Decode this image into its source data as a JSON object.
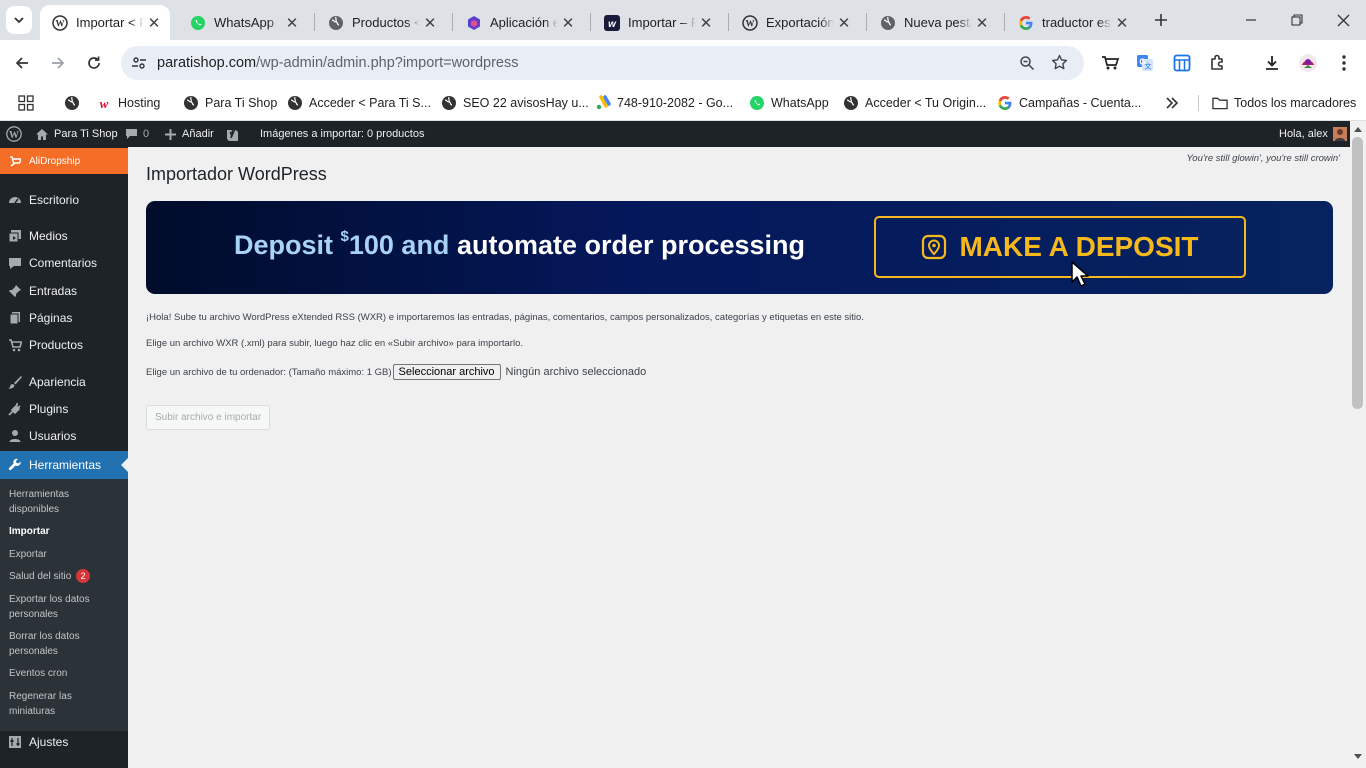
{
  "browser": {
    "tabs": [
      {
        "label": "Importar < P",
        "icon": "wordpress-icon",
        "active": true
      },
      {
        "label": "WhatsApp",
        "icon": "whatsapp-icon"
      },
      {
        "label": "Productos <",
        "icon": "globe-icon"
      },
      {
        "label": "Aplicación e",
        "icon": "app-icon"
      },
      {
        "label": "Importar – P",
        "icon": "w-logo-icon"
      },
      {
        "label": "Exportación",
        "icon": "wordpress-icon"
      },
      {
        "label": "Nueva pesta",
        "icon": "globe-icon"
      },
      {
        "label": "traductor es",
        "icon": "google-icon"
      }
    ],
    "url_domain": "paratishop.com",
    "url_path": "/wp-admin/admin.php?import=wordpress",
    "bookmarks": [
      {
        "label": "Hosting",
        "icon": "hosting-icon"
      },
      {
        "label": "Para Ti Shop",
        "icon": "globe-icon"
      },
      {
        "label": "Acceder < Para Ti S...",
        "icon": "globe-icon"
      },
      {
        "label": "SEO 22 avisosHay u...",
        "icon": "globe-icon"
      },
      {
        "label": "748-910-2082 - Go...",
        "icon": "google-ads-icon"
      },
      {
        "label": "WhatsApp",
        "icon": "whatsapp-icon"
      },
      {
        "label": "Acceder < Tu Origin...",
        "icon": "globe-icon"
      },
      {
        "label": "Campañas - Cuenta...",
        "icon": "google-icon"
      }
    ],
    "all_bookmarks": "Todos los marcadores"
  },
  "adminbar": {
    "site": "Para Ti Shop",
    "comments": "0",
    "add": "Añadir",
    "import_notice": "Imágenes a importar: 0 productos",
    "greeting": "Hola, alex"
  },
  "sidebar": {
    "top_item": "AliDropship",
    "items": [
      "Escritorio",
      "Medios",
      "Comentarios",
      "Entradas",
      "Páginas",
      "Productos",
      "Apariencia",
      "Plugins",
      "Usuarios",
      "Herramientas"
    ],
    "submenu": [
      "Herramientas disponibles",
      "Importar",
      "Exportar",
      "Salud del sitio",
      "Exportar los datos personales",
      "Borrar los datos personales",
      "Eventos cron",
      "Regenerar las miniaturas"
    ],
    "health_badge": "2",
    "settings": "Ajustes"
  },
  "main": {
    "tagline": "You're still glowin', you're still crowin'",
    "title": "Importador WordPress",
    "banner": {
      "deposit": "Deposit",
      "currency": "$",
      "amount": "100 and",
      "rest": "automate order processing",
      "button": "MAKE A DEPOSIT"
    },
    "intro": "¡Hola! Sube tu archivo WordPress eXtended RSS (WXR) e importaremos las entradas, páginas, comentarios, campos personalizados, categorías y etiquetas en este sitio.",
    "instruction": "Elige un archivo WXR (.xml) para subir, luego haz clic en «Subir archivo» para importarlo.",
    "file_label": "Elige un archivo de tu ordenador: (Tamaño máximo: 1 GB)",
    "file_button": "Seleccionar archivo",
    "file_status": "Ningún archivo seleccionado",
    "submit": "Subir archivo e importar"
  },
  "colors": {
    "wp_dark": "#1d2327",
    "wp_blue": "#2271b1",
    "alidropship_orange": "#f56e28",
    "banner_gold": "#f5b91e",
    "banner_navy": "#06235f"
  }
}
